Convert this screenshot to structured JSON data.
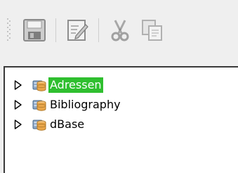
{
  "toolbar": {
    "buttons": [
      {
        "name": "save-button",
        "icon": "floppy-disk-icon",
        "enabled": false
      },
      {
        "name": "edit-button",
        "icon": "edit-document-icon",
        "enabled": false
      },
      {
        "name": "cut-button",
        "icon": "scissors-icon",
        "enabled": false
      },
      {
        "name": "copy-button",
        "icon": "copy-icon",
        "enabled": false
      }
    ]
  },
  "tree": {
    "items": [
      {
        "label": "Adressen",
        "icon": "database-icon",
        "selected": true
      },
      {
        "label": "Bibliography",
        "icon": "database-icon",
        "selected": false
      },
      {
        "label": "dBase",
        "icon": "database-icon",
        "selected": false
      }
    ]
  },
  "colors": {
    "selection": "#2fbf2f",
    "background": "#efefef"
  }
}
